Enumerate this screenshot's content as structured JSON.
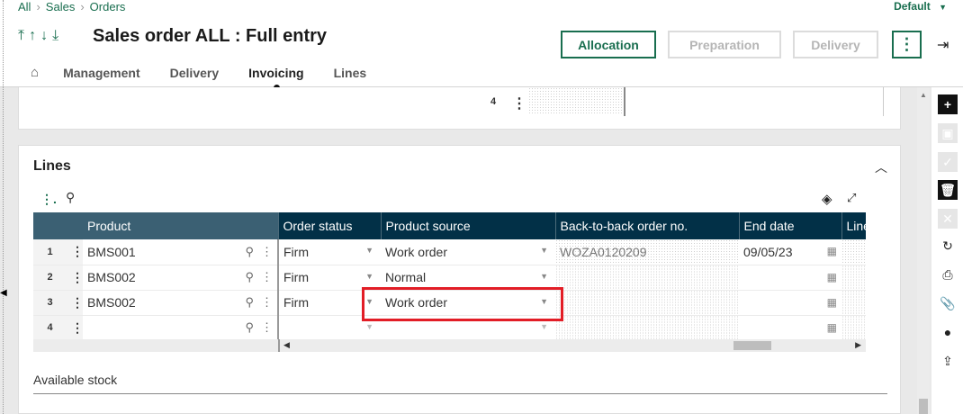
{
  "breadcrumb": [
    "All",
    "Sales",
    "Orders"
  ],
  "view_selector": "Default",
  "page_title": "Sales order ALL : Full entry",
  "actions": {
    "allocation": "Allocation",
    "preparation": "Preparation",
    "delivery": "Delivery"
  },
  "tabs": [
    "Management",
    "Delivery",
    "Invoicing",
    "Lines"
  ],
  "active_tab": "Invoicing",
  "upper_panel": {
    "row_number": "4"
  },
  "lines_section": {
    "title": "Lines",
    "columns": [
      "Product",
      "Order status",
      "Product source",
      "Back-to-back order no.",
      "End date",
      "Line"
    ],
    "rows": [
      {
        "num": "1",
        "product": "BMS001",
        "order_status": "Firm",
        "product_source": "Work order",
        "b2b_order": "WOZA0120209",
        "end_date": "09/05/23"
      },
      {
        "num": "2",
        "product": "BMS002",
        "order_status": "Firm",
        "product_source": "Normal",
        "b2b_order": "",
        "end_date": ""
      },
      {
        "num": "3",
        "product": "BMS002",
        "order_status": "Firm",
        "product_source": "Work order",
        "b2b_order": "",
        "end_date": ""
      },
      {
        "num": "4",
        "product": "",
        "order_status": "",
        "product_source": "",
        "b2b_order": "",
        "end_date": ""
      }
    ]
  },
  "available_stock": {
    "title": "Available stock"
  },
  "colors": {
    "brand_green": "#196e4f",
    "header_navy": "#023047",
    "highlight_red": "#e21d26"
  }
}
